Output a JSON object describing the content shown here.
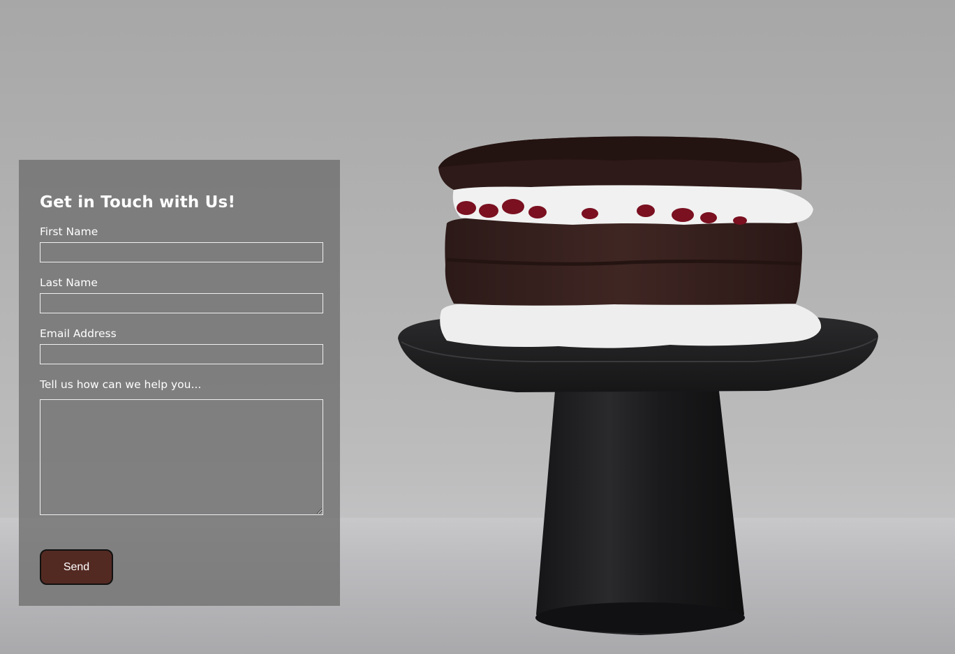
{
  "contact_form": {
    "title": "Get in Touch with Us!",
    "first_name_label": "First Name",
    "first_name_value": "",
    "last_name_label": "Last Name",
    "last_name_value": "",
    "email_label": "Email Address",
    "email_value": "",
    "message_label": "Tell us how can we help you...",
    "message_value": "",
    "send_label": "Send"
  },
  "colors": {
    "send_button": "#532a22",
    "panel": "#6e6e6e",
    "background": "#b3b3b3",
    "cake_stand": "#1c1c1e",
    "chocolate": "#3a2220",
    "cream": "#f2f2f2",
    "cherry": "#7a1020"
  },
  "background_image": {
    "icon": "chocolate-layer-cake-photo"
  }
}
